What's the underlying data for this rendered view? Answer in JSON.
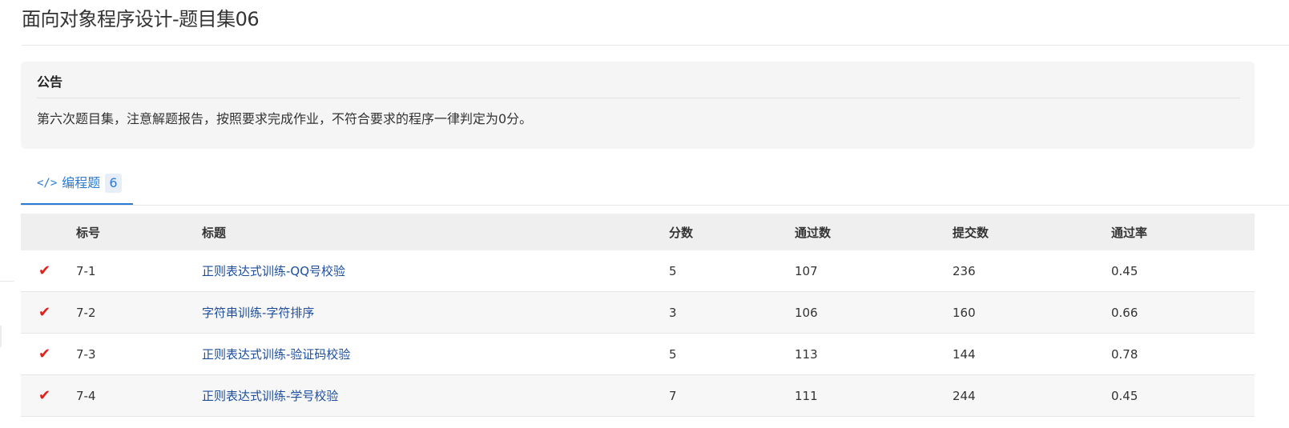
{
  "page": {
    "title": "面向对象程序设计-题目集06"
  },
  "notice": {
    "title": "公告",
    "body": "第六次题目集，注意解题报告，按照要求完成作业，不符合要求的程序一律判定为0分。"
  },
  "tab": {
    "icon": "</>",
    "label": "编程题",
    "count": "6"
  },
  "table": {
    "headers": {
      "id": "标号",
      "title": "标题",
      "score": "分数",
      "passed": "通过数",
      "submitted": "提交数",
      "rate": "通过率"
    },
    "rows": [
      {
        "status_icon": "✔",
        "id": "7-1",
        "title": "正则表达式训练-QQ号校验",
        "score": "5",
        "passed": "107",
        "submitted": "236",
        "rate": "0.45"
      },
      {
        "status_icon": "✔",
        "id": "7-2",
        "title": "字符串训练-字符排序",
        "score": "3",
        "passed": "106",
        "submitted": "160",
        "rate": "0.66"
      },
      {
        "status_icon": "✔",
        "id": "7-3",
        "title": "正则表达式训练-验证码校验",
        "score": "5",
        "passed": "113",
        "submitted": "144",
        "rate": "0.78"
      },
      {
        "status_icon": "✔",
        "id": "7-4",
        "title": "正则表达式训练-学号校验",
        "score": "7",
        "passed": "111",
        "submitted": "244",
        "rate": "0.45"
      }
    ]
  },
  "colors": {
    "accent": "#2b7bd6",
    "link": "#1d4e9e",
    "check": "#e0221c"
  }
}
